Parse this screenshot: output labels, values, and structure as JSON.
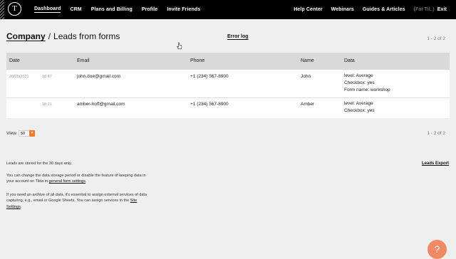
{
  "brand": {
    "logo_letter": "T"
  },
  "nav": {
    "left": [
      "Dashboard",
      "CRM",
      "Plans and Billing",
      "Profile",
      "Invite Friends"
    ],
    "right": [
      "Help Center",
      "Webinars",
      "Guides & Articles"
    ],
    "account": "(For Til..)",
    "exit": "Exit"
  },
  "breadcrumb": {
    "parent": "Company",
    "separator": "/",
    "current": "Leads from forms"
  },
  "error_log": "Error log",
  "pager_text": "1 - 2 of 2",
  "table": {
    "headers": [
      "Date",
      "Email",
      "Phone",
      "Name",
      "Data"
    ],
    "rows": [
      {
        "date": "28/09/2021",
        "time": "18:47",
        "email": "john.doe@gmail.com",
        "phone": "+1 (234) 567-8900",
        "name": "John",
        "data": [
          "level: Average",
          "Checkbox: yes",
          "Form name: workshop"
        ]
      },
      {
        "date": "",
        "time": "18:31",
        "email": "amber-hoff@gmail.com",
        "phone": "+1 (234) 567-8900",
        "name": "Amber",
        "data": [
          "level: Average",
          "Checkbox: yes"
        ]
      }
    ]
  },
  "view": {
    "label": "View",
    "value": "50"
  },
  "notes": {
    "retention": "Leads are stored for the 30 days only.",
    "storage_pre": "You can change the data storage period or disable the feature of keeping data in your account on Tilda in",
    "storage_link": "general form settings",
    "archive_pre": "If you need an archive of all data, it's essential to assign external services of data capturing, e.g., email or Google Sheets. You can assign services in the",
    "archive_link": "Site Settings"
  },
  "leads_export": "Leads Export",
  "help_symbol": "?"
}
